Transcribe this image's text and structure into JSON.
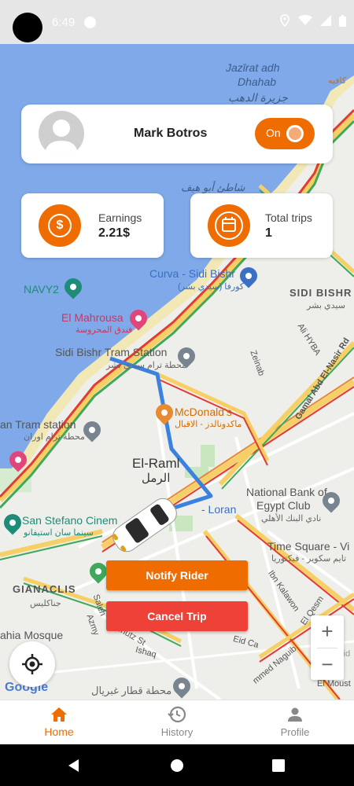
{
  "status_bar": {
    "time": "6:49"
  },
  "driver": {
    "name": "Mark Botros",
    "status_toggle_label": "On"
  },
  "stats": {
    "earnings_label": "Earnings",
    "earnings_value": "2.21$",
    "trips_label": "Total trips",
    "trips_value": "1",
    "earnings_icon": "dollar-icon",
    "trips_icon": "calendar-icon"
  },
  "map": {
    "labels": {
      "jazirat_1": "Jazīrat adh",
      "jazirat_2": "Dhahab",
      "jazirat_ar": "جزيرة الدهب",
      "cafe_ar": "كافيه",
      "shati_ar": "شاطئ أبو هيف",
      "curva": "Curva - Sidi Bishr",
      "curva_ar": "كورفا (سيدي بشر)",
      "navy2": "NAVY2",
      "sidi_bishr": "SIDI BISHR",
      "sidi_bishr_ar": "سيدي بشر",
      "mahrousa": "El Mahrousa",
      "mahrousa_ar": "فندق المحروسة",
      "tram_station": "Sidi Bishr Tram Station",
      "tram_station_ar": "محطة ترام سيدي بشر",
      "zeinab": "Zeinab",
      "ali_hyba": "Ali HYBA",
      "gamal": "Gamal Abd El-Nasir Rd",
      "mcdonalds": "McDonald's",
      "mcdonalds_ar": "ماكدونالدز - الاقبال",
      "an_tram": "an Tram station",
      "an_tram_ar": "محطة ترام اوران",
      "el_raml": "El-Raml",
      "el_raml_ar": "الرمل",
      "loran": "- Loran",
      "nbe": "National Bank of",
      "nbe_2": "Egypt Club",
      "nbe_ar": "نادي البنك الأهلي",
      "san_stefano": "San Stefano Cinem",
      "san_stefano_ar": "سينما سان استيفانو",
      "time_square": "Time Square - Vi",
      "time_square_ar": "تايم سكوير - فيكتوريا",
      "gianaclis": "GIANACLIS",
      "gianaclis_ar": "جناكليس",
      "mosque": "ahia Mosque",
      "ibn_kalawon": "Ibn Kalawon",
      "el_qesm": "El Qesm",
      "saleh": "Saleh",
      "azmy": "Azmy",
      "schutz": "Schutz St",
      "ishaq": "Ishaq",
      "eid_ca": "Eid Ca",
      "mohammed_naguib": "mmed Naguib",
      "bort_said": "Bort Said",
      "el_moust": "El Moust",
      "gheryal_ar": "محطة قطار غبريال",
      "google": "Google"
    },
    "zoom_in": "+",
    "zoom_out": "−"
  },
  "actions": {
    "notify": "Notify Rider",
    "cancel": "Cancel Trip"
  },
  "nav": {
    "home": "Home",
    "history": "History",
    "profile": "Profile"
  },
  "colors": {
    "accent": "#ef6c00",
    "cancel": "#ee4238",
    "route": "#3b82e0",
    "water": "#7fa9e8"
  }
}
